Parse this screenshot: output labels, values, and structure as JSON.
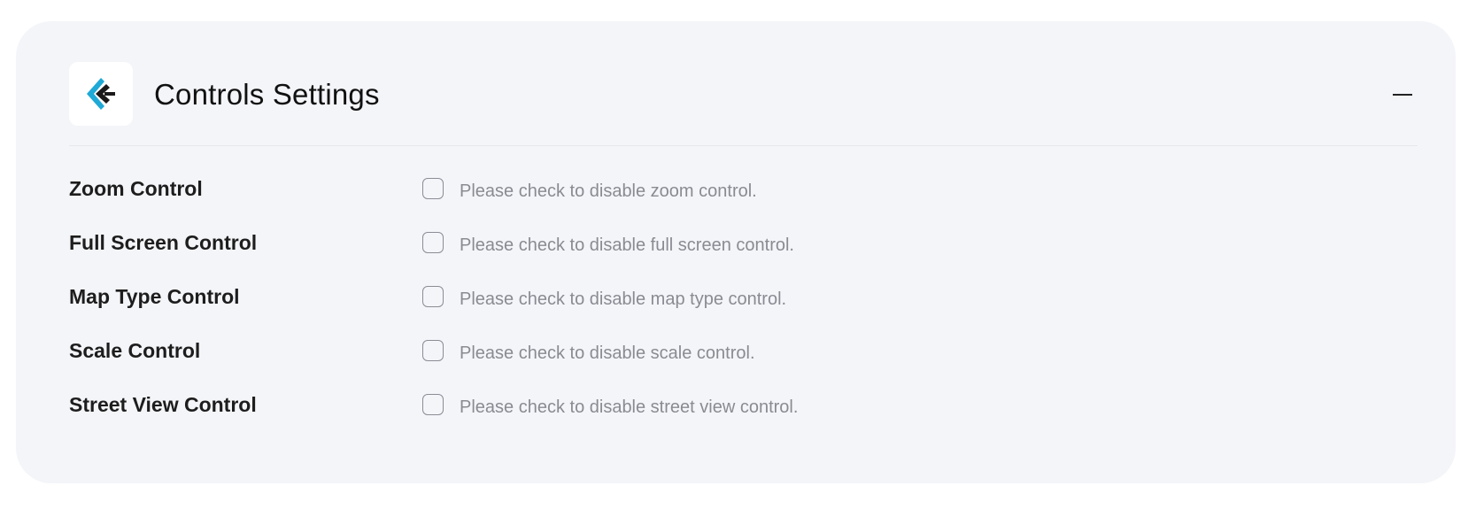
{
  "header": {
    "title": "Controls Settings",
    "logo_icon": "brand-logo-icon",
    "collapse_icon": "minus-icon"
  },
  "colors": {
    "panel_background": "#f4f5f9",
    "logo_accent_blue": "#1fa9d6",
    "logo_dark": "#1a1a1a",
    "label_text": "#1d1d1d",
    "description_text": "#8a8b92"
  },
  "controls": [
    {
      "label": "Zoom Control",
      "description": "Please check to disable zoom control.",
      "checked": false
    },
    {
      "label": "Full Screen Control",
      "description": "Please check to disable full screen control.",
      "checked": false
    },
    {
      "label": "Map Type Control",
      "description": "Please check to disable map type control.",
      "checked": false
    },
    {
      "label": "Scale Control",
      "description": "Please check to disable scale control.",
      "checked": false
    },
    {
      "label": "Street View Control",
      "description": "Please check to disable street view control.",
      "checked": false
    }
  ]
}
